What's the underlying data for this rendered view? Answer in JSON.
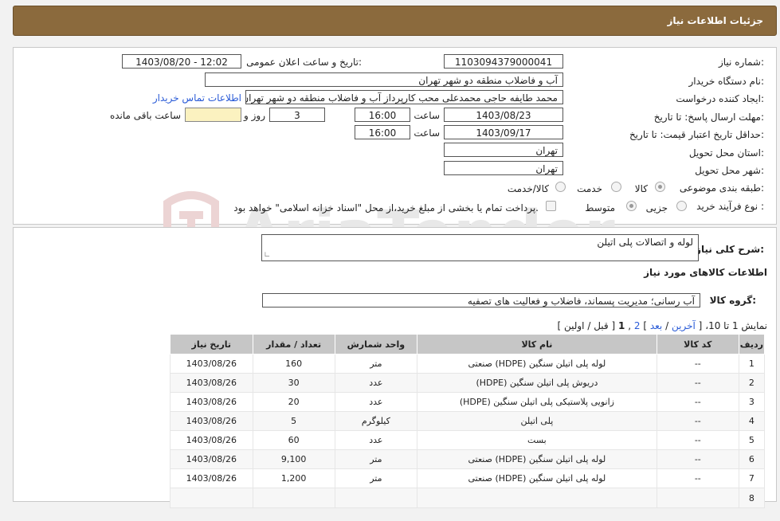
{
  "header": {
    "title": "جزئیات اطلاعات نیاز"
  },
  "form": {
    "need_number_label": "شماره نیاز:",
    "need_number": "1103094379000041",
    "announce_label": "تاریخ و ساعت اعلان عمومی:",
    "announce_value": "1403/08/20 - 12:02",
    "buyer_org_label": "نام دستگاه خریدار:",
    "buyer_org": "آب و فاضلاب منطقه دو شهر تهران",
    "requester_label": "ایجاد کننده درخواست:",
    "requester": "محمد طایفه حاجی محمدعلی محب کارپرداز آب و فاضلاب منطقه دو شهر تهران",
    "contact_link": "اطلاعات تماس خریدار",
    "deadline_label": "مهلت ارسال پاسخ: تا تاریخ:",
    "deadline_date": "1403/08/23",
    "time_label": "ساعت",
    "deadline_time": "16:00",
    "days_value": "3",
    "days_label": "روز و",
    "remaining_value": "",
    "remaining_label": "ساعت باقی مانده",
    "validity_label": "حداقل تاریخ اعتبار قیمت: تا تاریخ:",
    "validity_date": "1403/09/17",
    "validity_time": "16:00",
    "province_label": "استان محل تحویل:",
    "province": "تهران",
    "city_label": "شهر محل تحویل:",
    "city": "تهران",
    "category_label": "طبقه بندی موضوعی:",
    "category_options": [
      "کالا",
      "خدمت",
      "کالا/خدمت"
    ],
    "process_label": "نوع فرآیند خرید :",
    "process_options": [
      "جزیی",
      "متوسط"
    ],
    "payment_note": "پرداخت تمام یا بخشی از مبلغ خرید،از محل \"اسناد خزانه اسلامی\" خواهد بود."
  },
  "summary": {
    "general_desc_label": "شرح کلی نیاز:",
    "general_desc": "لوله و اتصالات پلی اتیلن",
    "goods_info_title": "اطلاعات کالاهای مورد نیاز",
    "goods_group_label": "گروه کالا:",
    "goods_group": "آب رسانی؛ مدیریت پسماند، فاضلاب و فعالیت های تصفیه"
  },
  "pagination": {
    "showing": "نمایش 1 تا 10،",
    "last": "آخرین",
    "next": "بعد",
    "page2": "2",
    "page1": "1",
    "prev": "قبل",
    "first": "اولین"
  },
  "table": {
    "headers": [
      "ردیف",
      "کد کالا",
      "نام کالا",
      "واحد شمارش",
      "تعداد / مقدار",
      "تاریخ نیاز"
    ],
    "rows": [
      [
        "1",
        "--",
        "لوله پلی اتیلن سنگین (HDPE) صنعتی",
        "متر",
        "160",
        "1403/08/26"
      ],
      [
        "2",
        "--",
        "دریوش پلی اتیلن سنگین (HDPE)",
        "عدد",
        "30",
        "1403/08/26"
      ],
      [
        "3",
        "--",
        "زانویی پلاستیکی پلی اتیلن سنگین (HDPE)",
        "عدد",
        "20",
        "1403/08/26"
      ],
      [
        "4",
        "--",
        "پلی اتیلن",
        "کیلوگرم",
        "5",
        "1403/08/26"
      ],
      [
        "5",
        "--",
        "بست",
        "عدد",
        "60",
        "1403/08/26"
      ],
      [
        "6",
        "--",
        "لوله پلی اتیلن سنگین (HDPE) صنعتی",
        "متر",
        "9,100",
        "1403/08/26"
      ],
      [
        "7",
        "--",
        "لوله پلی اتیلن سنگین (HDPE) صنعتی",
        "متر",
        "1,200",
        "1403/08/26"
      ],
      [
        "8",
        "",
        "",
        "",
        "",
        ""
      ]
    ]
  },
  "watermark": {
    "text": "AriaTender.neT"
  }
}
